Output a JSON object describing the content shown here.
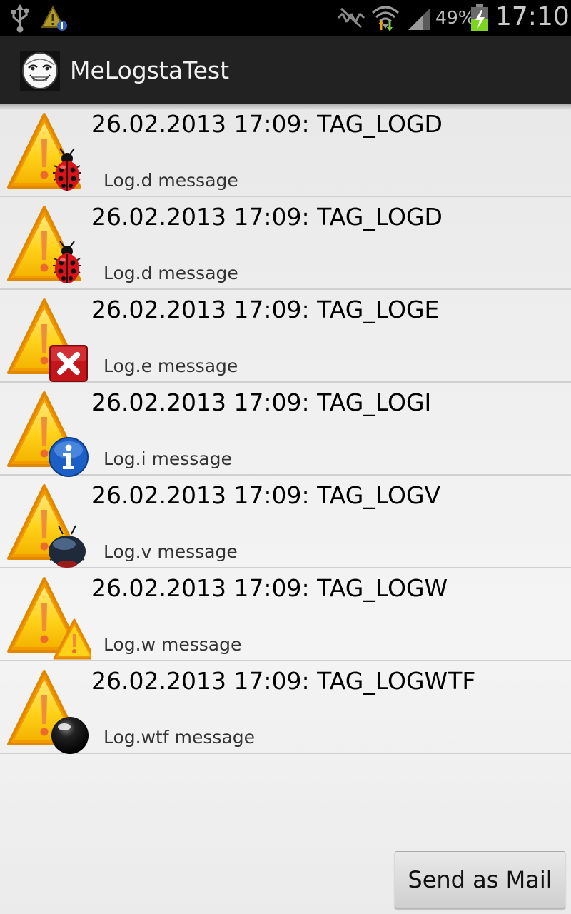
{
  "status_bar": {
    "battery": "49%",
    "time": "17:10",
    "icons": [
      "usb-icon",
      "warning-info-icon",
      "mute-icon",
      "wifi-icon",
      "signal-icon",
      "battery-charging-icon"
    ]
  },
  "action_bar": {
    "app_icon": "trollface-app-icon",
    "title": "MeLogstaTest"
  },
  "logs": [
    {
      "title": "26.02.2013 17:09: TAG_LOGD",
      "message": "Log.d message",
      "level": "debug",
      "badge": "ladybug-icon"
    },
    {
      "title": "26.02.2013 17:09: TAG_LOGD",
      "message": "Log.d message",
      "level": "debug",
      "badge": "ladybug-icon"
    },
    {
      "title": "26.02.2013 17:09: TAG_LOGE",
      "message": "Log.e message",
      "level": "error",
      "badge": "error-x-icon"
    },
    {
      "title": "26.02.2013 17:09: TAG_LOGI",
      "message": "Log.i message",
      "level": "info",
      "badge": "info-icon"
    },
    {
      "title": "26.02.2013 17:09: TAG_LOGV",
      "message": "Log.v message",
      "level": "verbose",
      "badge": "dark-bug-icon"
    },
    {
      "title": "26.02.2013 17:09: TAG_LOGW",
      "message": "Log.w message",
      "level": "warn",
      "badge": "small-warning-icon"
    },
    {
      "title": "26.02.2013 17:09: TAG_LOGWTF",
      "message": "Log.wtf message",
      "level": "wtf",
      "badge": "black-ball-icon"
    }
  ],
  "actions": {
    "send_label": "Send as Mail"
  },
  "colors": {
    "status_bar_bg": "#000000",
    "action_bar_bg": "#222222",
    "warning_yellow": "#ffd21a",
    "warning_orange": "#f29a00",
    "battery_green": "#7ed321"
  }
}
